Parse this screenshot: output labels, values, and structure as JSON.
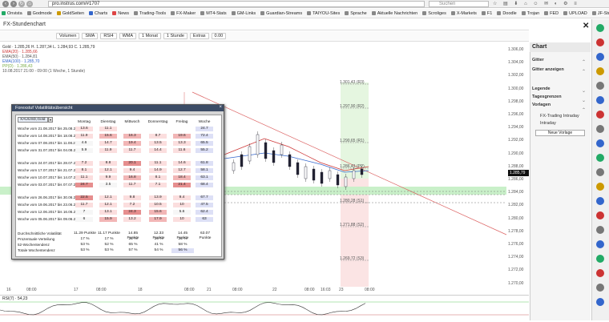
{
  "browser": {
    "url": "pro.instrus.com/#1707",
    "search_placeholder": "Suchen",
    "bookmarks": [
      {
        "label": "Onvista",
        "color": "#2a6"
      },
      {
        "label": "Godmode",
        "color": "#888"
      },
      {
        "label": "GoldSeiten",
        "color": "#c90"
      },
      {
        "label": "Charts",
        "color": "#36c"
      },
      {
        "label": "News",
        "color": "#d44"
      },
      {
        "label": "Trading-Tools",
        "color": "#888"
      },
      {
        "label": "FX-Maker",
        "color": "#888"
      },
      {
        "label": "MT4-Stats",
        "color": "#888"
      },
      {
        "label": "GM-Links",
        "color": "#888"
      },
      {
        "label": "Guardian-Streams",
        "color": "#888"
      },
      {
        "label": "TAIYOU-Sites",
        "color": "#888"
      },
      {
        "label": "Sprache",
        "color": "#888"
      },
      {
        "label": "Aktuelle Nachrichten",
        "color": "#888"
      },
      {
        "label": "Scroliges",
        "color": "#888"
      },
      {
        "label": "X-Markets",
        "color": "#888"
      },
      {
        "label": "F1",
        "color": "#888"
      },
      {
        "label": "Doodle",
        "color": "#888"
      },
      {
        "label": "Trojan",
        "color": "#888"
      },
      {
        "label": "FED",
        "color": "#888"
      },
      {
        "label": "UPLOAD",
        "color": "#888"
      },
      {
        "label": "JF-Studie",
        "color": "#888"
      }
    ]
  },
  "window": {
    "title": "FX-Stundenchart"
  },
  "toolbar": {
    "buttons": [
      "Volumen",
      "SMA",
      "RSI4",
      "WMA",
      "1 Monat",
      "1 Stunde",
      "Extras",
      "0.00"
    ]
  },
  "legend": {
    "instrument": "Gold · 1.285,26 H. 1.287,34 L. 1.284,93 C. 1.285,79",
    "lines": [
      "EMA(20) · 1.285,66",
      "EMA(50) · 1.284,81",
      "EMA(100) · 1.285,70",
      "PP(D) · 1.286,43",
      "10.08.2017 21:00 - 09:00 (1 Woche, 1 Stunde)"
    ]
  },
  "chart": {
    "yticks": [
      "1.306,00",
      "1.304,00",
      "1.302,00",
      "1.300,00",
      "1.298,00",
      "1.296,00",
      "1.294,00",
      "1.292,00",
      "1.290,00",
      "1.288,00",
      "1.286,00",
      "1.284,00",
      "1.282,00",
      "1.280,00",
      "1.278,00",
      "1.276,00",
      "1.274,00",
      "1.272,00",
      "1.270,00"
    ],
    "price_badge": "1.285,79",
    "xticks": [
      "16",
      "08:00",
      "17",
      "08:00",
      "18",
      "08:00",
      "21",
      "08:00",
      "22",
      "08:00",
      "16:03",
      "23",
      "08:00"
    ],
    "pivots": [
      "1.301,43 (R3)",
      "1.297,90 (R2)",
      "1.290,65 (R1)",
      "1.286,43 (PP)",
      "1.280,28 (S1)",
      "1.271,88 (S2)",
      "1.269,72 (S3)"
    ],
    "rsi_label": "RSI(7) · 54,23"
  },
  "sidepanel": {
    "title": "Chart",
    "items": [
      "Gitter",
      "Gitter anzeigen",
      "Legende",
      "Tagesgrenzen",
      "Vorlagen",
      "FX-Trading Intraday",
      "Intraday",
      "Neue Vorlage"
    ]
  },
  "stats": {
    "title": "Forexstuf Volatilitätsübersicht",
    "dropdown": "XAUUSD,Gold",
    "headers": [
      "Montag",
      "Dienstag",
      "Mittwoch",
      "Donnerstag",
      "Freitag",
      "Woche"
    ],
    "rows": [
      {
        "label": "Woche vom 21.08.2017 bis 25.08.2017",
        "vals": [
          "13.6",
          "11.1",
          "",
          "",
          "",
          "24.7"
        ]
      },
      {
        "label": "Woche vom 14.08.2017 bis 18.08.2017",
        "vals": [
          "11.9",
          "15.6",
          "16.3",
          "8.7",
          "19.6",
          "72.4"
        ]
      },
      {
        "label": "Woche vom 07.08.2017 bis 11.08.2017",
        "vals": [
          "4.6",
          "14.7",
          "19.4",
          "13.5",
          "13.3",
          "65.5"
        ]
      },
      {
        "label": "Woche vom 31.07.2017 bis 04.08.2017",
        "vals": [
          "5.9",
          "11.9",
          "11.7",
          "14.4",
          "11.6",
          "55.2"
        ]
      },
      {
        "label": "Woche vom 24.07.2017 bis 28.07.2017",
        "vals": [
          "7.2",
          "8.8",
          "20.1",
          "11.1",
          "14.6",
          "61.8"
        ]
      },
      {
        "label": "Woche vom 17.07.2017 bis 21.07.2017",
        "vals": [
          "8.1",
          "12.1",
          "9.4",
          "14.9",
          "12.7",
          "58.1"
        ]
      },
      {
        "label": "Woche vom 10.07.2017 bis 14.07.2017",
        "vals": [
          "11.1",
          "9.9",
          "16.8",
          "8.1",
          "18.4",
          "63.1"
        ]
      },
      {
        "label": "Woche vom 03.07.2017 bis 07.07.2017",
        "vals": [
          "24.7",
          "3.5",
          "11.7",
          "7.1",
          "21.4",
          "68.4"
        ]
      },
      {
        "label": "Woche vom 26.06.2017 bis 30.06.2017",
        "vals": [
          "22.5",
          "12.1",
          "9.8",
          "13.9",
          "9.4",
          "67.7"
        ]
      },
      {
        "label": "Woche vom 19.06.2017 bis 23.06.2017",
        "vals": [
          "11.7",
          "12.1",
          "7.2",
          "10.5",
          "10",
          "47.5"
        ]
      },
      {
        "label": "Woche vom 12.06.2017 bis 16.06.2017",
        "vals": [
          "7",
          "13.1",
          "24.3",
          "15.6",
          "5.6",
          "62.4"
        ]
      },
      {
        "label": "Woche vom 05.06.2017 bis 09.06.2017",
        "vals": [
          "6",
          "15.9",
          "13.2",
          "17.9",
          "10",
          "63"
        ]
      }
    ],
    "summary": [
      {
        "label": "Durchschnittliche Volatilität",
        "vals": [
          "11.29 Punkte",
          "11.17 Punkte",
          "14.85 Punkte",
          "12.33 Punkte",
          "14.45 Punkte",
          "63.07 Punkte"
        ]
      },
      {
        "label": "Prozentuale Verteilung",
        "vals": [
          "17 %",
          "17 %",
          "22 %",
          "19 %",
          "22 %",
          ""
        ]
      },
      {
        "label": "52-Wochentendenz",
        "vals": [
          "53 %",
          "52 %",
          "65 %",
          "41 %",
          "58 %",
          ""
        ]
      },
      {
        "label": "Totale Wochentendenz",
        "vals": [
          "53 %",
          "53 %",
          "57 %",
          "54 %",
          "56 %",
          ""
        ]
      }
    ]
  }
}
